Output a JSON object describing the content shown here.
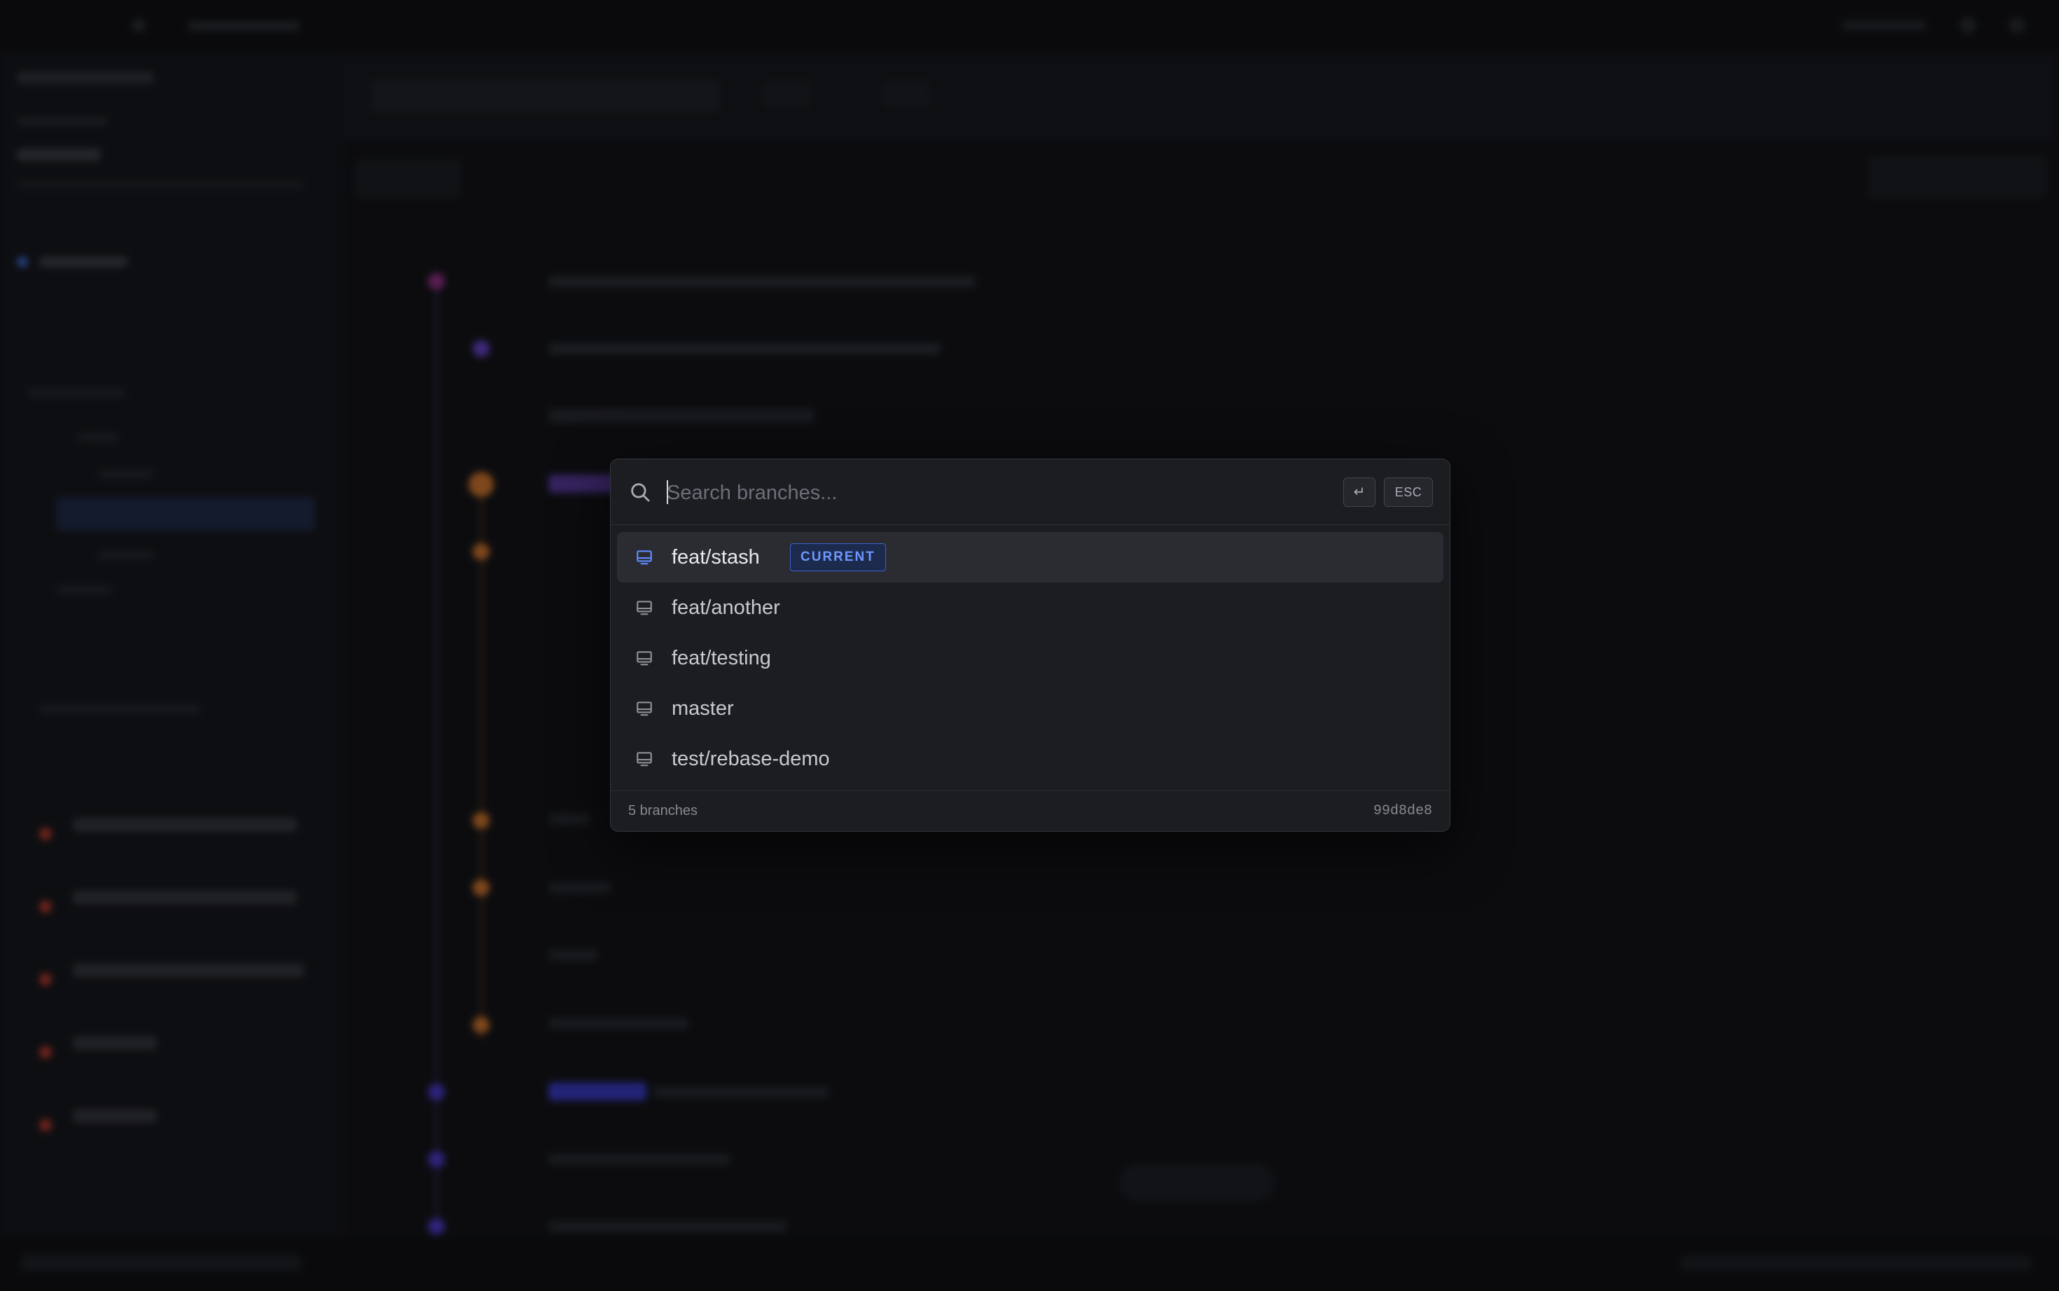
{
  "search": {
    "placeholder": "Search branches...",
    "enter_key": "↵",
    "esc_key": "ESC"
  },
  "branches": [
    {
      "name": "feat/stash",
      "current": true,
      "badge": "CURRENT"
    },
    {
      "name": "feat/another",
      "current": false
    },
    {
      "name": "feat/testing",
      "current": false
    },
    {
      "name": "master",
      "current": false
    },
    {
      "name": "test/rebase-demo",
      "current": false
    }
  ],
  "footer": {
    "count_label": "5 branches",
    "commit_hash": "99d8de8"
  },
  "colors": {
    "accent": "#6f97ff",
    "modal_bg": "#1c1d21",
    "current_row_bg": "#2a2c31",
    "lane_purple": "#7a4bd6",
    "lane_orange": "#e07b2a"
  }
}
